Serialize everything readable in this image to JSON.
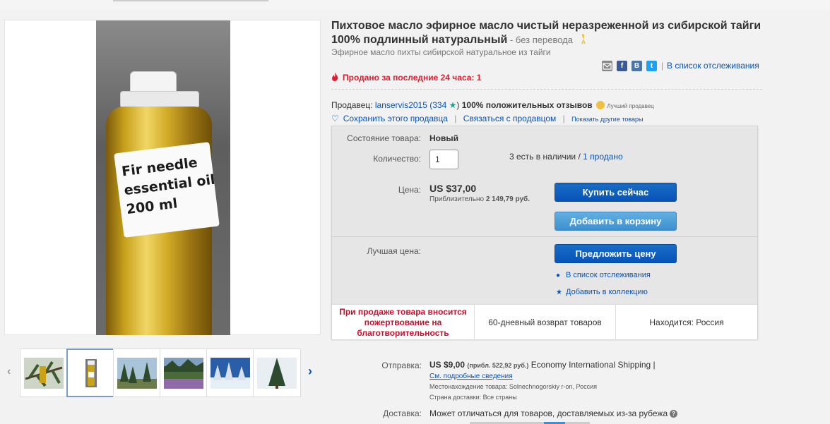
{
  "product": {
    "title": "Пихтовое масло эфирное масло чистый неразреженной из сибирской тайги 100% подлинный натуральный",
    "title_suffix": " - ",
    "no_translation": "без перевода",
    "subtitle": "Эфирное масло пихты сибирской натуральное из тайги",
    "image_label": "Fir needle\nessential oil\n200 ml",
    "sold_24h": "Продано за последние 24 часа: 1"
  },
  "share": {
    "icons": [
      "email-icon",
      "facebook-icon",
      "vkontakte-icon",
      "twitter-icon"
    ],
    "facebook_glyph": "f",
    "vk_glyph": "B",
    "twitter_glyph": "t",
    "separator": "|",
    "watchlist_label": "В список отслеживания"
  },
  "seller": {
    "label": "Продавец:",
    "name": "lanservis2015",
    "feedback_count": "(334",
    "star": "★",
    "close_paren": ")",
    "positive": "100% положительных отзывов",
    "top_seller": "Лучший продавец",
    "save_label": "Сохранить этого продавца",
    "contact_label": "Связаться с продавцом",
    "other_items": "Показать другие товары",
    "heart": "♡",
    "pipe": "|"
  },
  "buybox": {
    "condition_label": "Состояние товара:",
    "condition_value": "Новый",
    "quantity_label": "Количество:",
    "quantity_value": "1",
    "stock": "3 есть в наличии",
    "stock_sep": " / ",
    "sold_link": "1 продано",
    "price_label": "Цена:",
    "price": "US $37,00",
    "approx_prefix": "Приблизительно ",
    "approx_value": "2 149,79 руб.",
    "buy_now": "Купить сейчас",
    "add_to_cart": "Добавить в корзину",
    "best_offer_label": "Лучшая цена:",
    "make_offer": "Предложить цену",
    "watch_link": "В список отслеживания",
    "collection_link": "Добавить в коллекцию",
    "charity": "При продаже товара вносится пожертвование на благотворительность",
    "returns": "60-дневный возврат товаров",
    "location": "Находится: Россия"
  },
  "shipping": {
    "label": "Отправка:",
    "price": "US $9,00",
    "approx": "(прибл. 522,92 руб.)",
    "service": "Economy International Shipping |",
    "details_link": "См. подробные сведения",
    "location_line": "Местонахождение товара:  Solnechnogorskiy r-on, Россия",
    "countries_line": "Страна доставки:  Все страны",
    "delivery_label": "Доставка:",
    "delivery_value": "Может отличаться для товаров, доставляемых из-за рубежа",
    "info_glyph": "?"
  },
  "thumbnails": {
    "prev": "‹",
    "next": "›",
    "items": [
      "thumb-branch",
      "thumb-bottle",
      "thumb-forest",
      "thumb-mountain-meadow",
      "thumb-snow-forest",
      "thumb-fir-tree"
    ],
    "selected_index": 1
  },
  "colors": {
    "link": "#0654ba",
    "alert": "#dd1e31",
    "button_primary": "#0654ba",
    "button_secondary": "#3d8fcf"
  }
}
